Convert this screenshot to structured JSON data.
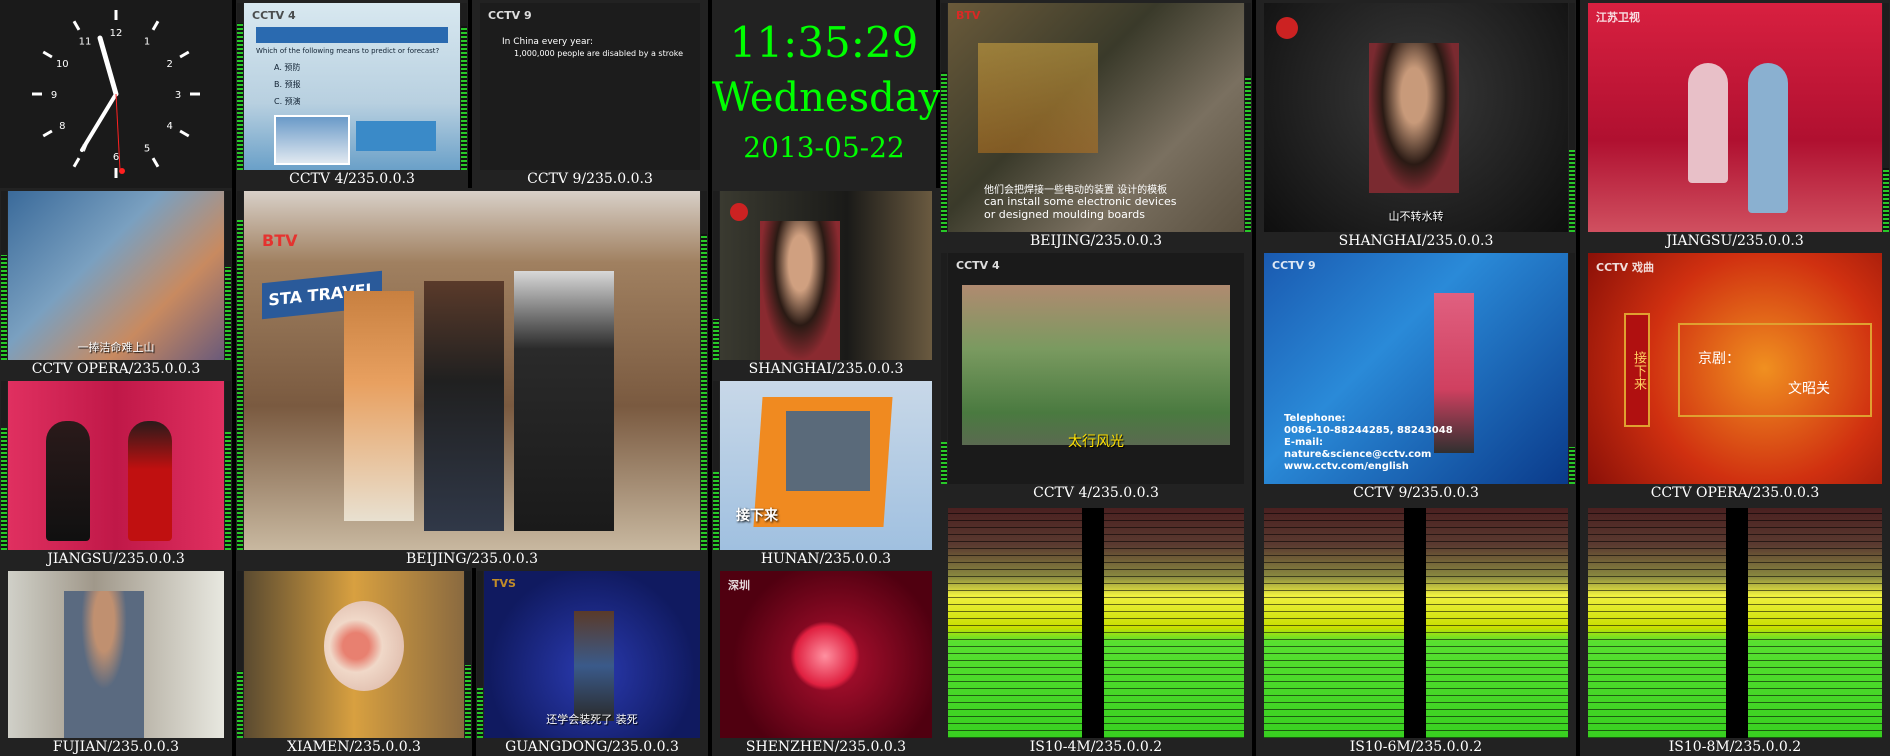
{
  "clock": {
    "time": "11:35:29",
    "day": "Wednesday",
    "date": "2013-05-22",
    "numerals": [
      "12",
      "1",
      "2",
      "3",
      "4",
      "5",
      "6",
      "7",
      "8",
      "9",
      "10",
      "11"
    ]
  },
  "channels": {
    "cctv4_top": {
      "label": "CCTV 4/235.0.0.3",
      "logo": "CCTV 4",
      "line1": "Which of the following means to predict or forecast?",
      "options": [
        "A.  预防",
        "B.  预报",
        "C.  预演"
      ]
    },
    "cctv9_top": {
      "label": "CCTV 9/235.0.0.3",
      "logo": "CCTV 9",
      "line1": "In China every year:",
      "line2": "1,000,000 people are disabled by a stroke"
    },
    "beijing_top": {
      "label": "BEIJING/235.0.0.3",
      "logo": "BTV",
      "cn": "他们会把焊接一些电动的装置 设计的模板",
      "en1": "can install some electronic devices",
      "en2": "or designed moulding boards"
    },
    "shanghai_top": {
      "label": "SHANGHAI/235.0.0.3",
      "sub": "山不转水转"
    },
    "jiangsu_top": {
      "label": "JIANGSU/235.0.0.3",
      "logo": "江苏卫视"
    },
    "cctv_opera_mid": {
      "label": "CCTV OPERA/235.0.0.3",
      "sub": "一捧洁命难上山"
    },
    "beijing_big": {
      "label": "BEIJING/235.0.0.3",
      "logo": "BTV",
      "sign": "STA TRAVEL"
    },
    "shanghai_mid": {
      "label": "SHANGHAI/235.0.0.3"
    },
    "cctv4_mid": {
      "label": "CCTV 4/235.0.0.3",
      "logo": "CCTV 4",
      "sub": "太行风光"
    },
    "cctv9_mid": {
      "label": "CCTV 9/235.0.0.3",
      "logo": "CCTV 9",
      "tel": "Telephone:",
      "num": "0086-10-88244285, 88243048",
      "email": "E-mail:",
      "addr": "nature&science@cctv.com",
      "web": "www.cctv.com/english"
    },
    "cctv_opera_right": {
      "label": "CCTV OPERA/235.0.0.3",
      "logo": "CCTV 戏曲",
      "t1": "京剧：",
      "t2": "文昭关",
      "v": "接下来"
    },
    "jiangsu_mid": {
      "label": "JIANGSU/235.0.0.3"
    },
    "hunan": {
      "label": "HUNAN/235.0.0.3",
      "sub": "接下来"
    },
    "fujian": {
      "label": "FUJIAN/235.0.0.3"
    },
    "xiamen": {
      "label": "XIAMEN/235.0.0.3"
    },
    "guangdong": {
      "label": "GUANGDONG/235.0.0.3",
      "logo": "TVS",
      "sub": "还学会装死了 装死"
    },
    "shenzhen": {
      "label": "SHENZHEN/235.0.0.3",
      "logo": "深圳"
    }
  },
  "meters": [
    {
      "label": "IS10-4M/235.0.0.2"
    },
    {
      "label": "IS10-6M/235.0.0.2"
    },
    {
      "label": "IS10-8M/235.0.0.2"
    }
  ],
  "colors": {
    "clock_text": "#00ff00",
    "label_text": "#ffffff",
    "bg": "#000000"
  }
}
